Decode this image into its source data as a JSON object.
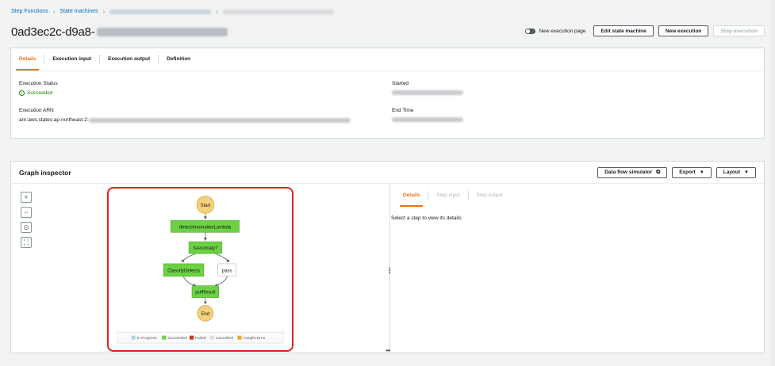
{
  "breadcrumb": {
    "items": [
      "Step Functions",
      "State machines"
    ]
  },
  "header": {
    "title": "0ad3ec2c-d9a8-",
    "toggle_label": "New execution page",
    "edit_label": "Edit state machine",
    "new_exec_label": "New execution",
    "stop_label": "Stop execution"
  },
  "details": {
    "tabs": [
      "Details",
      "Execution input",
      "Execution output",
      "Definition"
    ],
    "status_label": "Execution Status",
    "status_value": "Succeeded",
    "arn_label": "Execution ARN",
    "arn_prefix": "arn:aws:states:ap-northeast-2:",
    "started_label": "Started",
    "endtime_label": "End Time"
  },
  "graph": {
    "title": "Graph inspector",
    "simulator_label": "Data flow simulator",
    "export_label": "Export",
    "layout_label": "Layout",
    "zoom_in": "+",
    "zoom_out": "−",
    "center": "⊙",
    "fit": "⛶",
    "nodes": {
      "start": "Start",
      "detect": "detectAnomaliesLambda",
      "choice": "IsAnomaly?",
      "classify": "ClassifyDefects",
      "pass": "pass",
      "put": "putResult",
      "end": "End"
    },
    "legend": [
      "In Progress",
      "Succeeded",
      "Failed",
      "Cancelled",
      "Caught Error"
    ],
    "colors": {
      "succeeded": "#6cd243",
      "in_progress": "#a8d4ee",
      "failed": "#d13212",
      "cancelled": "#dddddd",
      "caught": "#f5a623",
      "terminal": "#f3d07a",
      "highlight": "#e02020"
    }
  },
  "inspector": {
    "tabs": [
      "Details",
      "Step input",
      "Step output"
    ],
    "hint": "Select a step to view its details."
  }
}
